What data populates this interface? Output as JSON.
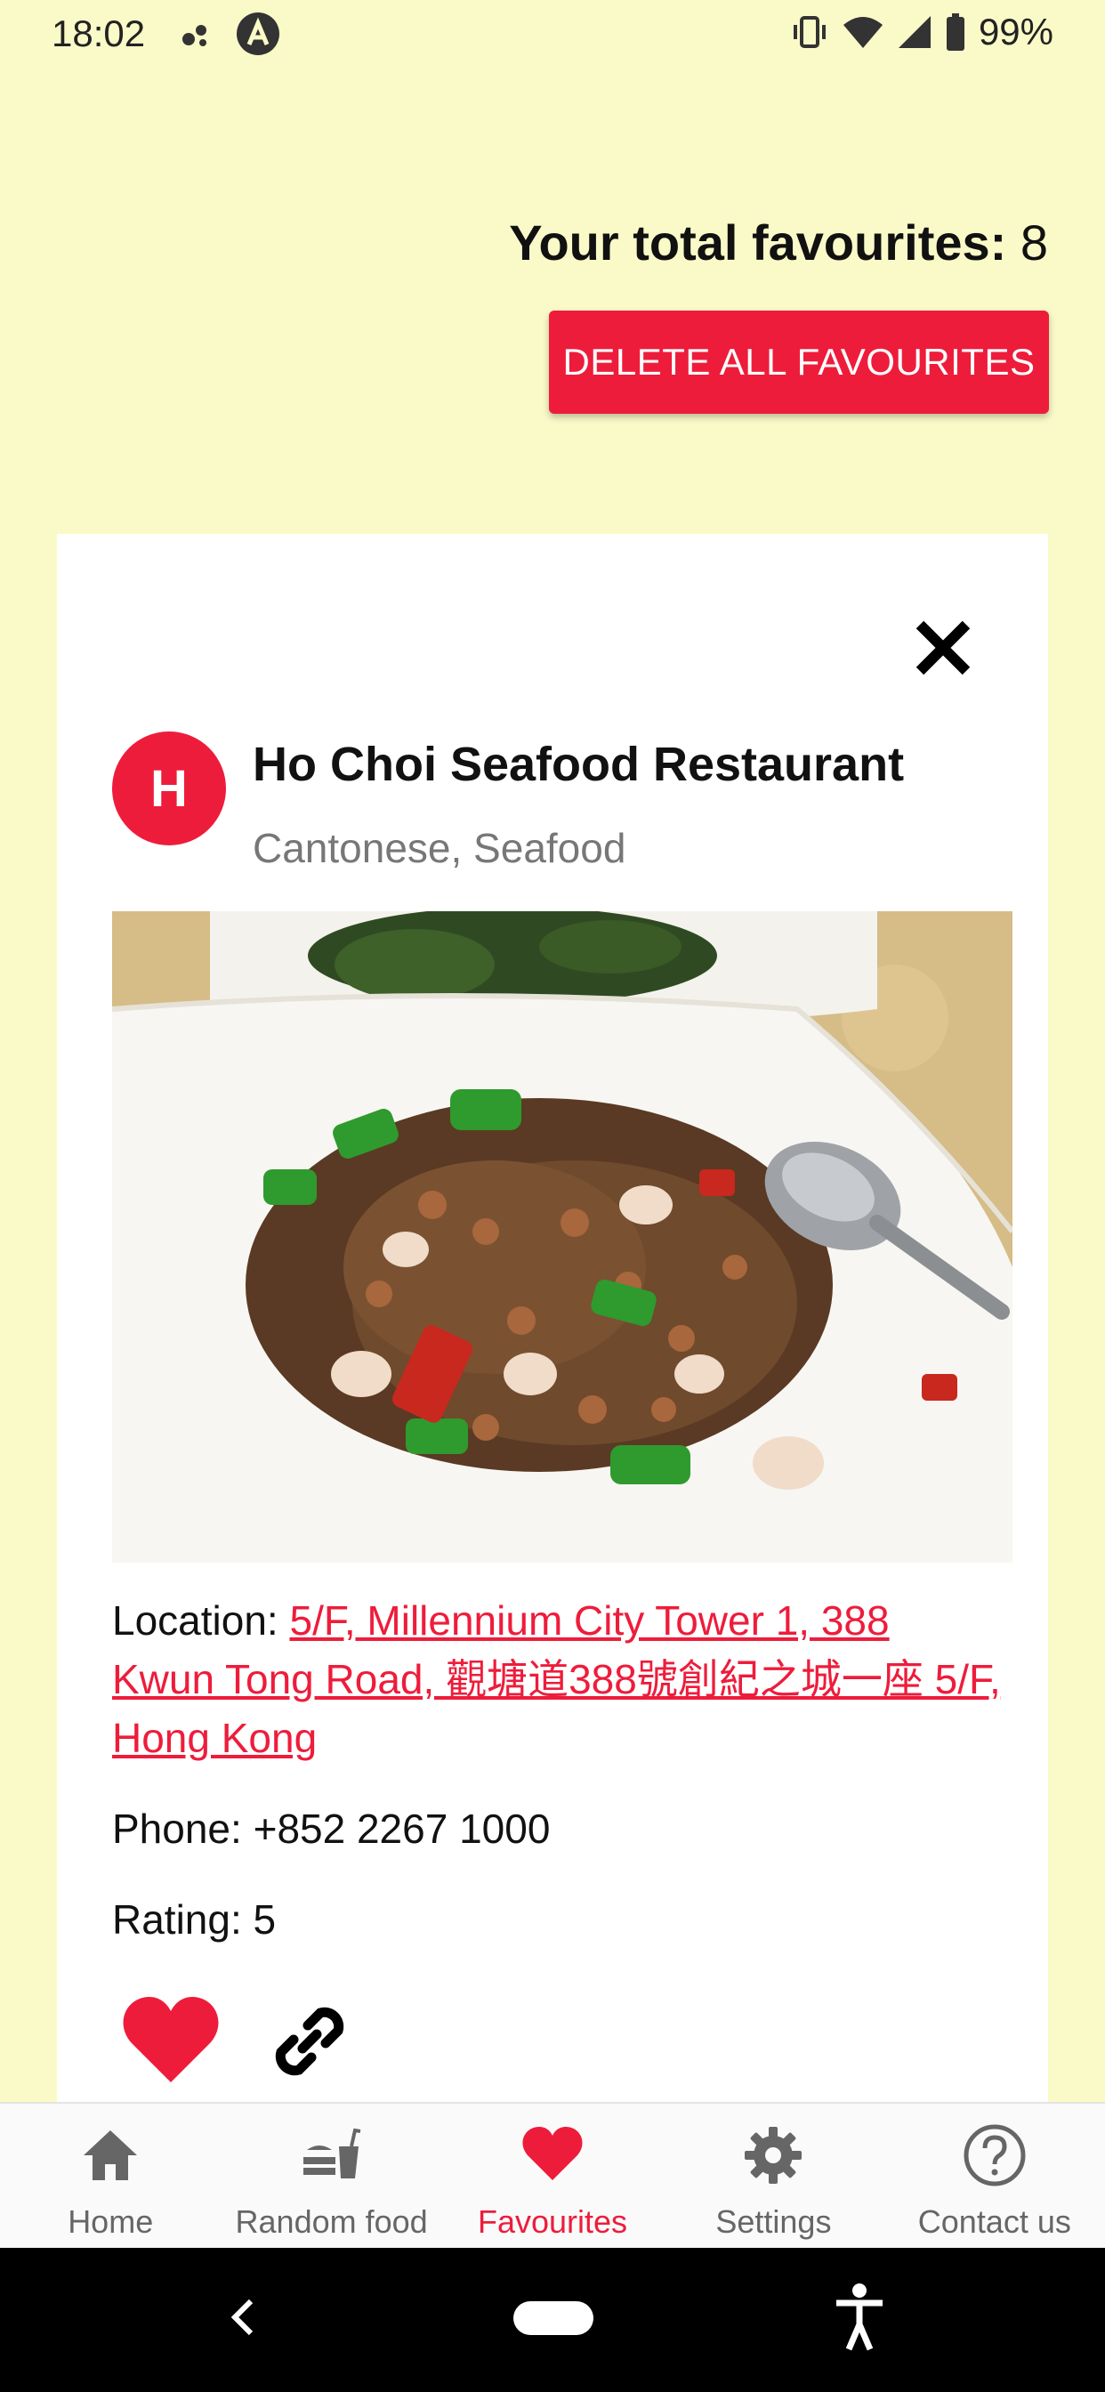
{
  "status_bar": {
    "time": "18:02",
    "battery": "99%",
    "icons": [
      "notification-dots-icon",
      "a-circle-icon",
      "vibrate-icon",
      "wifi-icon",
      "signal-icon",
      "battery-icon"
    ]
  },
  "header": {
    "total_label": "Your total favourites:",
    "total_count": "8",
    "delete_all_label": "DELETE ALL FAVOURITES"
  },
  "card": {
    "avatar_letter": "H",
    "name": "Ho Choi Seafood Restaurant",
    "cuisine": "Cantonese, Seafood",
    "location_label": "Location:",
    "location_address": "5/F, Millennium City Tower 1, 388 Kwun Tong Road, 觀塘道388號創紀之城一座 5/F, Hong Kong",
    "phone": "Phone: +852 2267 1000",
    "rating": "Rating: 5"
  },
  "bottom_nav": {
    "items": [
      {
        "label": "Home",
        "icon": "home-icon"
      },
      {
        "label": "Random food",
        "icon": "fastfood-icon"
      },
      {
        "label": "Favourites",
        "icon": "heart-icon",
        "active": true
      },
      {
        "label": "Settings",
        "icon": "gear-icon"
      },
      {
        "label": "Contact us",
        "icon": "help-circle-icon"
      }
    ]
  },
  "colors": {
    "background": "#FAFAC8",
    "accent": "#EE1C3B",
    "nav_inactive": "#666666"
  }
}
